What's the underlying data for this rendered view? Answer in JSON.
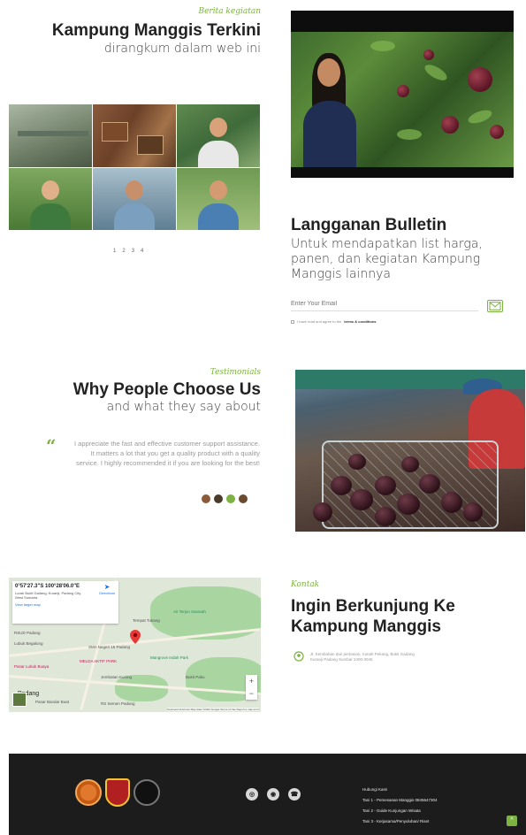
{
  "news": {
    "kicker": "Berita kegiatan",
    "title": "Kampung Manggis Terkini",
    "subtitle": "dirangkum dalam web ini",
    "pager": [
      "1",
      "2",
      "3",
      "4"
    ]
  },
  "bulletin": {
    "title": "Langganan Bulletin",
    "subtitle": "Untuk mendapatkan list harga, panen, dan kegiatan Kampung Manggis lainnya",
    "email_placeholder": "Enter Your Email",
    "consent_prefix": "I have read and agree to the ",
    "consent_link": "terms & conditions"
  },
  "testimonials": {
    "kicker": "Testimonials",
    "title": "Why People Choose Us",
    "subtitle": "and what they say about",
    "quote_mark": "“",
    "text": "I appreciate the fast and effective customer support assistance. It matters a lot that you get a quality product with a quality service. I highly recommended it if you are looking for the best!"
  },
  "map": {
    "coords": "0°57'27.3\"S 100°28'06.0\"E",
    "address": "Lurah Bukit Gadang, Kuranji, Padang City, West Sumatra",
    "view_larger": "View larger map",
    "directions": "Directions",
    "labels": {
      "padang": "Padang",
      "pasar_bandar_buat": "Pasar Bandar Buat",
      "rsud": "RSUD Padang",
      "lubuk_begalung": "Lubuk Begalung",
      "sma": "SMA Negeri 15 Padang",
      "rs": "RS Semen Padang",
      "sdn": "SDN 01 Lubuk Kilangan",
      "tempat_tukang": "Tempat Tukang",
      "pasar": "Pasar Lubuk Buaya",
      "air_terjun": "Air Terjun Sarasah",
      "melda": "MELDA AKTIF PARK",
      "mangrove": "Mangrove Indah Park",
      "bukit": "Bukit Paku",
      "jembatan": "Jembatan Kuning"
    },
    "zoom_in": "+",
    "zoom_out": "−",
    "attribution": "Keyboard shortcuts   Map data ©2022 Google   Terms of Use   Report a map error"
  },
  "contact": {
    "kicker": "Kontak",
    "title": "Ingin Berkunjung Ke Kampung Manggis",
    "address": "Jl. Kembahan dari pertanian, rumah Pekang, Bukit Gadang Kuranji Padang Sumbar 2400-3045"
  },
  "footer": {
    "links": [
      "Hubungi Kami",
      "Tani 1 - Pemesanan Manggis 0845647304",
      "Tani 2 - Guide Kunjungan Wisata",
      "Tani 3 - Kerjasama/Penyuluhan/ Riset"
    ],
    "to_top": "^"
  }
}
